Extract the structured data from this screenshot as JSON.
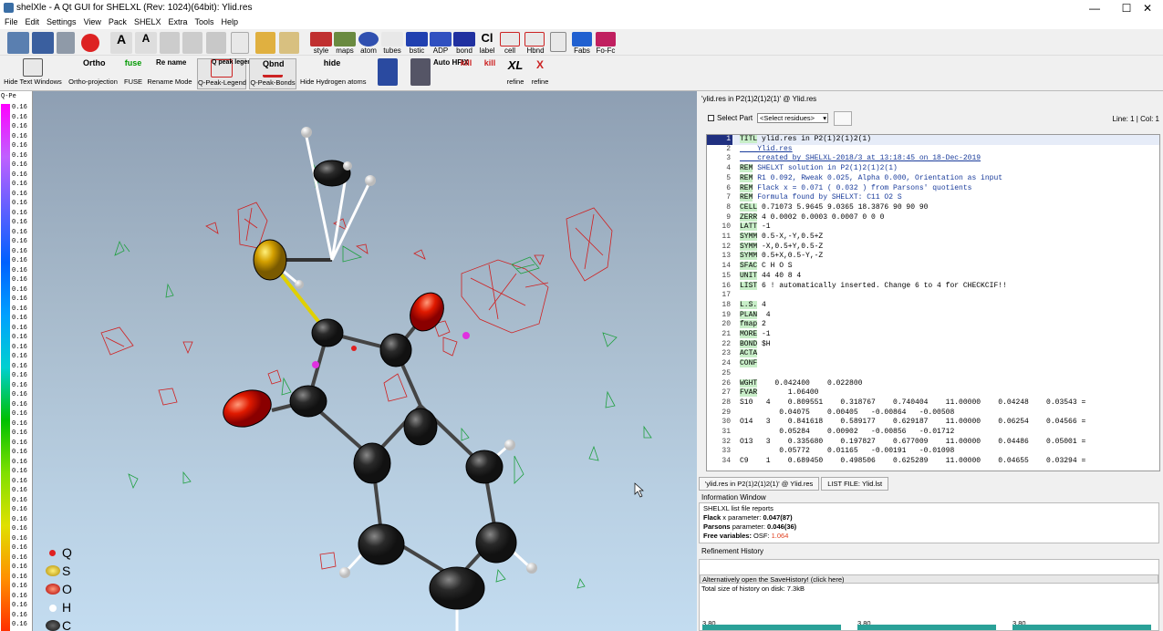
{
  "window": {
    "title": "shelXle - A Qt GUI for SHELXL (Rev: 1024)(64bit): Ylid.res",
    "min": "—",
    "max": "☐",
    "close": "✕"
  },
  "menu": [
    "File",
    "Edit",
    "Settings",
    "View",
    "Pack",
    "SHELX",
    "Extra",
    "Tools",
    "Help"
  ],
  "toolbar1": {
    "labels": [
      "style",
      "maps",
      "atom",
      "tubes",
      "bstic",
      "ADP",
      "bond",
      "label",
      "cell",
      "Hbnd",
      "Fabs",
      "Fo-Fc"
    ],
    "cl": "Cl"
  },
  "toolbar2": [
    "Hide Text Windows",
    "Ortho-projection",
    "FUSE",
    "Rename Mode",
    "Q-Peak-Legend",
    "Q-Peak-Bonds",
    "Hide Hydrogen atoms"
  ],
  "toolbar2_extra": {
    "ortho": "Ortho",
    "fuse": "fuse",
    "rename": "Re name",
    "qpk": "Q peak legend",
    "qbnd": "Qbnd",
    "hide": "hide",
    "auto": "Auto HFIX",
    "kill": "kill",
    "xl": "XL",
    "refine": "refine"
  },
  "qpeak": {
    "header": "Q-Pe",
    "value": "0.16"
  },
  "legend": [
    {
      "sym": "Q",
      "color": "#e02020"
    },
    {
      "sym": "S",
      "color": "#d6d000"
    },
    {
      "sym": "O",
      "color": "#e02020"
    },
    {
      "sym": "H",
      "color": "#ffffff"
    },
    {
      "sym": "C",
      "color": "#222222"
    }
  ],
  "editor": {
    "header": "'ylid.res in P2(1)2(1)2(1)' @ Ylid.res",
    "select_part": "Select Part",
    "select_residues": "<Select residues>",
    "line_col": "Line: 1 | Col: 1",
    "lines": [
      {
        "n": "1",
        "t": "TITL ylid.res in P2(1)2(1)2(1)"
      },
      {
        "n": "2",
        "t": "    Ylid.res"
      },
      {
        "n": "3",
        "t": "    created by SHELXL-2018/3 at 13:18:45 on 18-Dec-2019"
      },
      {
        "n": "4",
        "t": "REM SHELXT solution in P2(1)2(1)2(1)"
      },
      {
        "n": "5",
        "t": "REM R1 0.092, Rweak 0.025, Alpha 0.000, Orientation as input"
      },
      {
        "n": "6",
        "t": "REM Flack x = 0.071 ( 0.032 ) from Parsons' quotients"
      },
      {
        "n": "7",
        "t": "REM Formula found by SHELXT: C11 O2 S"
      },
      {
        "n": "8",
        "t": "CELL 0.71073 5.9645 9.0365 18.3876 90 90 90"
      },
      {
        "n": "9",
        "t": "ZERR 4 0.0002 0.0003 0.0007 0 0 0"
      },
      {
        "n": "10",
        "t": "LATT -1"
      },
      {
        "n": "11",
        "t": "SYMM 0.5-X,-Y,0.5+Z"
      },
      {
        "n": "12",
        "t": "SYMM -X,0.5+Y,0.5-Z"
      },
      {
        "n": "13",
        "t": "SYMM 0.5+X,0.5-Y,-Z"
      },
      {
        "n": "14",
        "t": "SFAC C H O S"
      },
      {
        "n": "15",
        "t": "UNIT 44 40 8 4"
      },
      {
        "n": "16",
        "t": "LIST 6 ! automatically inserted. Change 6 to 4 for CHECKCIF!!"
      },
      {
        "n": "17",
        "t": ""
      },
      {
        "n": "18",
        "t": "L.S. 4"
      },
      {
        "n": "19",
        "t": "PLAN  4"
      },
      {
        "n": "20",
        "t": "fmap 2"
      },
      {
        "n": "21",
        "t": "MORE -1"
      },
      {
        "n": "22",
        "t": "BOND $H"
      },
      {
        "n": "23",
        "t": "ACTA"
      },
      {
        "n": "24",
        "t": "CONF"
      },
      {
        "n": "25",
        "t": ""
      },
      {
        "n": "26",
        "t": "WGHT    0.042400    0.022800"
      },
      {
        "n": "27",
        "t": "FVAR       1.06400"
      },
      {
        "n": "28",
        "t": "S10   4    0.809551    0.318767    0.740404    11.00000    0.04248    0.03543 ="
      },
      {
        "n": "29",
        "t": "         0.04075    0.00405   -0.00864   -0.00508"
      },
      {
        "n": "30",
        "t": "O14   3    0.841618    0.589177    0.629187    11.00000    0.06254    0.04566 ="
      },
      {
        "n": "31",
        "t": "         0.05284    0.00902   -0.00856   -0.01712"
      },
      {
        "n": "32",
        "t": "O13   3    0.335680    0.197827    0.677009    11.00000    0.04486    0.05001 ="
      },
      {
        "n": "33",
        "t": "         0.05772    0.01165   -0.00191   -0.01098"
      },
      {
        "n": "34",
        "t": "C9    1    0.689450    0.498506    0.625289    11.00000    0.04655    0.03294 ="
      }
    ],
    "tabs": [
      "'ylid.res in P2(1)2(1)2(1)' @ Ylid.res",
      "LIST FILE: Ylid.lst"
    ]
  },
  "info": {
    "header": "Information Window",
    "lines": [
      {
        "a": "SHELXL list file reports",
        "b": ""
      },
      {
        "a": "Flack",
        "b": " x parameter: ",
        "c": "0.047(87)"
      },
      {
        "a": "Parsons",
        "b": " parameter: ",
        "c": "0.046(36)"
      },
      {
        "a": "Free variables:",
        "b": " OSF: ",
        "c": "1.064"
      }
    ]
  },
  "refinement": {
    "header": "Refinement History",
    "link": "Alternatively open the SaveHistory! (click here)",
    "size": "Total size of history on disk:    7.3kB",
    "values": [
      "3.80",
      "3.80",
      "3.80"
    ]
  }
}
